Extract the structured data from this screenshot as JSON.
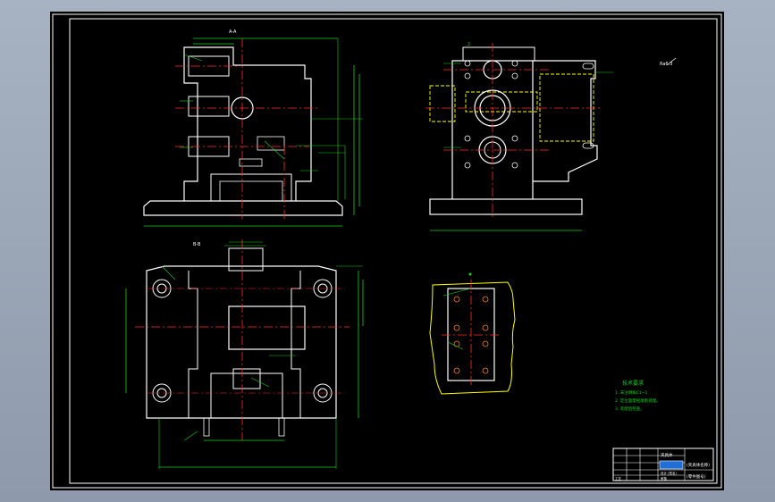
{
  "title_block": {
    "designation": "夹具体",
    "drawing_name_1": "(夹具体名称)",
    "drawing_name_2": "(零件图号)",
    "row_labels": [
      "设计 (签名)",
      "审核",
      "工艺"
    ]
  },
  "tech_requirements": {
    "heading": "技术要求",
    "items": [
      "1. 未注倒角C1~1",
      "2. 定位面需经磨削处理。",
      "3. 装配后检查。"
    ]
  },
  "roughness_note": "Ra6.3",
  "section_markers": {
    "top_left": "A-A",
    "bottom_left": "B-B",
    "front_top": "2"
  },
  "colors": {
    "background": "#000000",
    "outline": "#ffffff",
    "dimension": "#19d11e",
    "centerline": "#ff2a2a",
    "hidden": "#ffff00",
    "frame": "#ffffff"
  }
}
